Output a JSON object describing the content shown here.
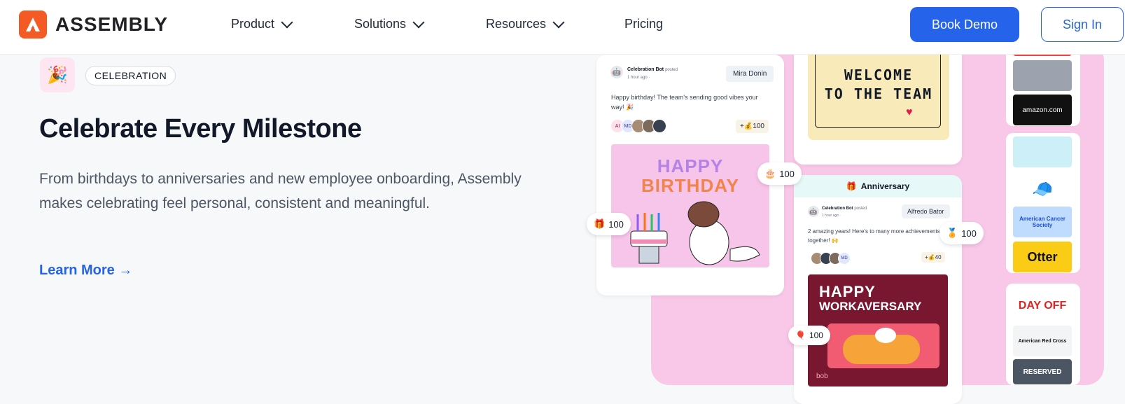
{
  "nav": {
    "brand": "ASSEMBLY",
    "items": [
      {
        "label": "Product"
      },
      {
        "label": "Solutions"
      },
      {
        "label": "Resources"
      },
      {
        "label": "Pricing"
      }
    ],
    "book_demo": "Book Demo",
    "sign_in": "Sign In"
  },
  "hero": {
    "badge": "CELEBRATION",
    "title": "Celebrate Every Milestone",
    "description": "From birthdays to anniversaries and new employee onboarding, Assembly makes celebrating feel personal, consistent and meaningful.",
    "learn_more": "Learn More →"
  },
  "collage": {
    "post1": {
      "author": "Celebration Bot",
      "action": "posted",
      "time": "1 hour ago ·",
      "recipient": "Mira Donin",
      "message": "Happy birthday! The team's sending good vibes your way! 🎉",
      "avatars": [
        "AI",
        "MD"
      ],
      "points": "+💰100",
      "card_line1": "HAPPY",
      "card_line2": "BIRTHDAY"
    },
    "welcome_line1": "WELCOME",
    "welcome_line2": "TO THE TEAM",
    "anniversary": {
      "header": "Anniversary",
      "author": "Celebration Bot",
      "action": "posted",
      "time": "1 hour ago ·",
      "recipient": "Alfredo Bator",
      "message": "2 amazing years! Here's to many more achievements together! 🙌",
      "avatars": [
        "MD"
      ],
      "points": "+💰40",
      "card_line1": "HAPPY",
      "card_line2": "WORKAVERSARY",
      "card_brand": "bob"
    },
    "pills": {
      "cake": "100",
      "gift": "100",
      "medal": "100",
      "balloon": "100"
    },
    "tiles": {
      "amazon": "amazon.com",
      "cancer": "American Cancer Society",
      "otter": "Otter",
      "dayoff": "DAY OFF",
      "redcross": "American Red Cross",
      "reserved": "RESERVED"
    }
  },
  "colors": {
    "accent": "#2563eb",
    "brand": "#f35a24",
    "pink": "#f9c8e8"
  }
}
